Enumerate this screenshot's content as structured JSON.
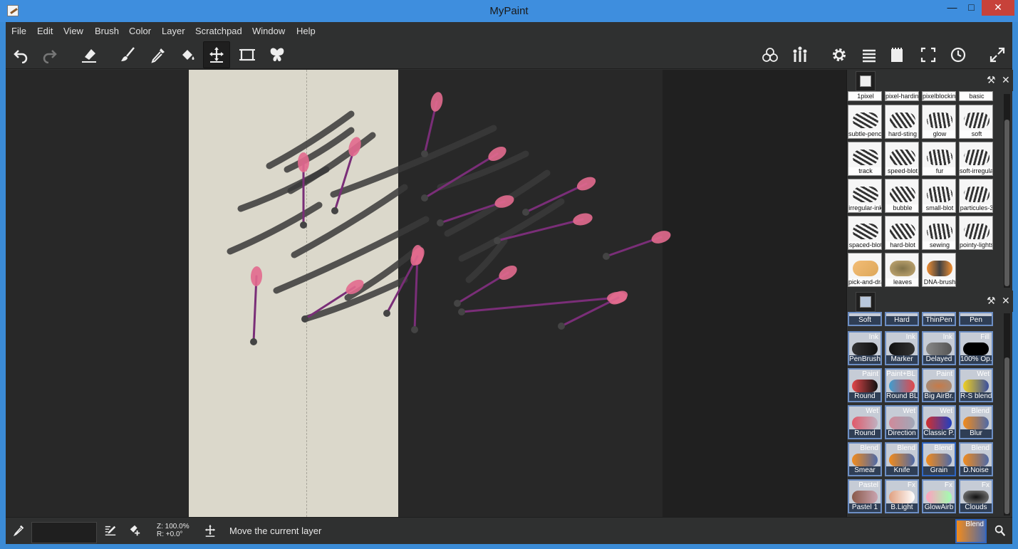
{
  "window": {
    "title": "MyPaint",
    "minimize": "—",
    "maximize": "□",
    "close": "✕"
  },
  "menu": [
    "File",
    "Edit",
    "View",
    "Brush",
    "Color",
    "Layer",
    "Scratchpad",
    "Window",
    "Help"
  ],
  "toolbar": {
    "left": [
      "undo-icon",
      "redo-icon",
      "eraser-icon",
      "brush-icon",
      "color-picker-icon",
      "fill-icon",
      "move-layer-icon",
      "frame-icon",
      "symmetry-icon"
    ],
    "right": [
      "color-wheel-icon",
      "brush-set-icon",
      "settings-icon",
      "layers-icon",
      "scratchpad-icon",
      "fullscreen-icon",
      "history-icon",
      "expand-icon"
    ],
    "active": "move-layer-icon"
  },
  "panel_top": {
    "row0": [
      "1pixel",
      "pixel-hardink",
      "pixelblocking",
      "basic"
    ],
    "brushes": [
      [
        "subtle-pencil",
        "hard-sting",
        "glow",
        "soft"
      ],
      [
        "track",
        "speed-blot",
        "fur",
        "soft-irregular"
      ],
      [
        "irregular-ink",
        "bubble",
        "small-blot",
        "particules-3"
      ],
      [
        "spaced-blot",
        "hard-blot",
        "sewing",
        "pointy-lightstrokes"
      ],
      [
        "pick-and-drag",
        "leaves",
        "DNA-brush"
      ]
    ]
  },
  "panel_bottom": {
    "row0": [
      "Soft",
      "Hard",
      "ThinPen",
      "Pen"
    ],
    "brushes": [
      [
        {
          "cat": "Ink",
          "label": "PenBrush"
        },
        {
          "cat": "Ink",
          "label": "Marker"
        },
        {
          "cat": "Ink",
          "label": "Delayed"
        },
        {
          "cat": "Fill",
          "label": "100% Op."
        }
      ],
      [
        {
          "cat": "Paint",
          "label": "Round"
        },
        {
          "cat": "Paint+BL",
          "label": "Round BL"
        },
        {
          "cat": "Paint",
          "label": "Big AirBr."
        },
        {
          "cat": "Wet",
          "label": "R-S blend"
        }
      ],
      [
        {
          "cat": "Wet",
          "label": "Round"
        },
        {
          "cat": "Wet",
          "label": "Direction"
        },
        {
          "cat": "Wet",
          "label": "Classic P."
        },
        {
          "cat": "Blend",
          "label": "Blur"
        }
      ],
      [
        {
          "cat": "Blend",
          "label": "Smear"
        },
        {
          "cat": "Blend",
          "label": "Knife"
        },
        {
          "cat": "Blend",
          "label": "Grain"
        },
        {
          "cat": "Blend",
          "label": "D.Noise"
        }
      ],
      [
        {
          "cat": "Pastel",
          "label": "Pastel 1"
        },
        {
          "cat": "Fx",
          "label": "B.Light"
        },
        {
          "cat": "Fx",
          "label": "GlowAirb"
        },
        {
          "cat": "Fx",
          "label": "Clouds"
        }
      ]
    ]
  },
  "status": {
    "zoom": "Z: 100.0%",
    "rotation": "R: +0.0°",
    "message": "Move the current layer",
    "current_brush_cat": "Blend"
  }
}
